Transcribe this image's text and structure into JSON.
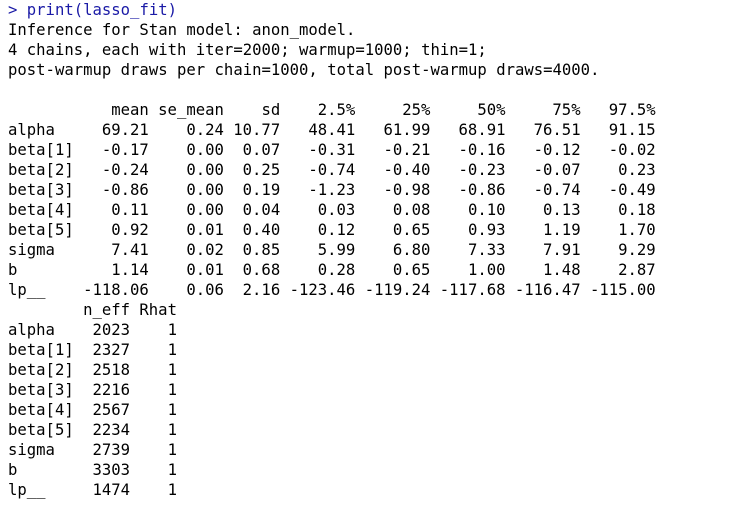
{
  "console": {
    "prompt": "> ",
    "command": "print(lasso_fit)",
    "header_lines": [
      "Inference for Stan model: anon_model.",
      "4 chains, each with iter=2000; warmup=1000; thin=1;",
      "post-warmup draws per chain=1000, total post-warmup draws=4000."
    ],
    "summary_table": {
      "columns": [
        "mean",
        "se_mean",
        "sd",
        "2.5%",
        "25%",
        "50%",
        "75%",
        "97.5%"
      ],
      "rows": [
        {
          "name": "alpha",
          "values": [
            "69.21",
            "0.24",
            "10.77",
            "48.41",
            "61.99",
            "68.91",
            "76.51",
            "91.15"
          ]
        },
        {
          "name": "beta[1]",
          "values": [
            "-0.17",
            "0.00",
            "0.07",
            "-0.31",
            "-0.21",
            "-0.16",
            "-0.12",
            "-0.02"
          ]
        },
        {
          "name": "beta[2]",
          "values": [
            "-0.24",
            "0.00",
            "0.25",
            "-0.74",
            "-0.40",
            "-0.23",
            "-0.07",
            "0.23"
          ]
        },
        {
          "name": "beta[3]",
          "values": [
            "-0.86",
            "0.00",
            "0.19",
            "-1.23",
            "-0.98",
            "-0.86",
            "-0.74",
            "-0.49"
          ]
        },
        {
          "name": "beta[4]",
          "values": [
            "0.11",
            "0.00",
            "0.04",
            "0.03",
            "0.08",
            "0.10",
            "0.13",
            "0.18"
          ]
        },
        {
          "name": "beta[5]",
          "values": [
            "0.92",
            "0.01",
            "0.40",
            "0.12",
            "0.65",
            "0.93",
            "1.19",
            "1.70"
          ]
        },
        {
          "name": "sigma",
          "values": [
            "7.41",
            "0.02",
            "0.85",
            "5.99",
            "6.80",
            "7.33",
            "7.91",
            "9.29"
          ]
        },
        {
          "name": "b",
          "values": [
            "1.14",
            "0.01",
            "0.68",
            "0.28",
            "0.65",
            "1.00",
            "1.48",
            "2.87"
          ]
        },
        {
          "name": "lp__",
          "values": [
            "-118.06",
            "0.06",
            "2.16",
            "-123.46",
            "-119.24",
            "-117.68",
            "-116.47",
            "-115.00"
          ]
        }
      ]
    },
    "diag_table": {
      "columns": [
        "n_eff",
        "Rhat"
      ],
      "rows": [
        {
          "name": "alpha",
          "values": [
            "2023",
            "1"
          ]
        },
        {
          "name": "beta[1]",
          "values": [
            "2327",
            "1"
          ]
        },
        {
          "name": "beta[2]",
          "values": [
            "2518",
            "1"
          ]
        },
        {
          "name": "beta[3]",
          "values": [
            "2216",
            "1"
          ]
        },
        {
          "name": "beta[4]",
          "values": [
            "2567",
            "1"
          ]
        },
        {
          "name": "beta[5]",
          "values": [
            "2234",
            "1"
          ]
        },
        {
          "name": "sigma",
          "values": [
            "2739",
            "1"
          ]
        },
        {
          "name": "b",
          "values": [
            "3303",
            "1"
          ]
        },
        {
          "name": "lp__",
          "values": [
            "1474",
            "1"
          ]
        }
      ]
    },
    "colors": {
      "command": "#1a1aa6",
      "output": "#000000",
      "background": "#ffffff"
    }
  }
}
